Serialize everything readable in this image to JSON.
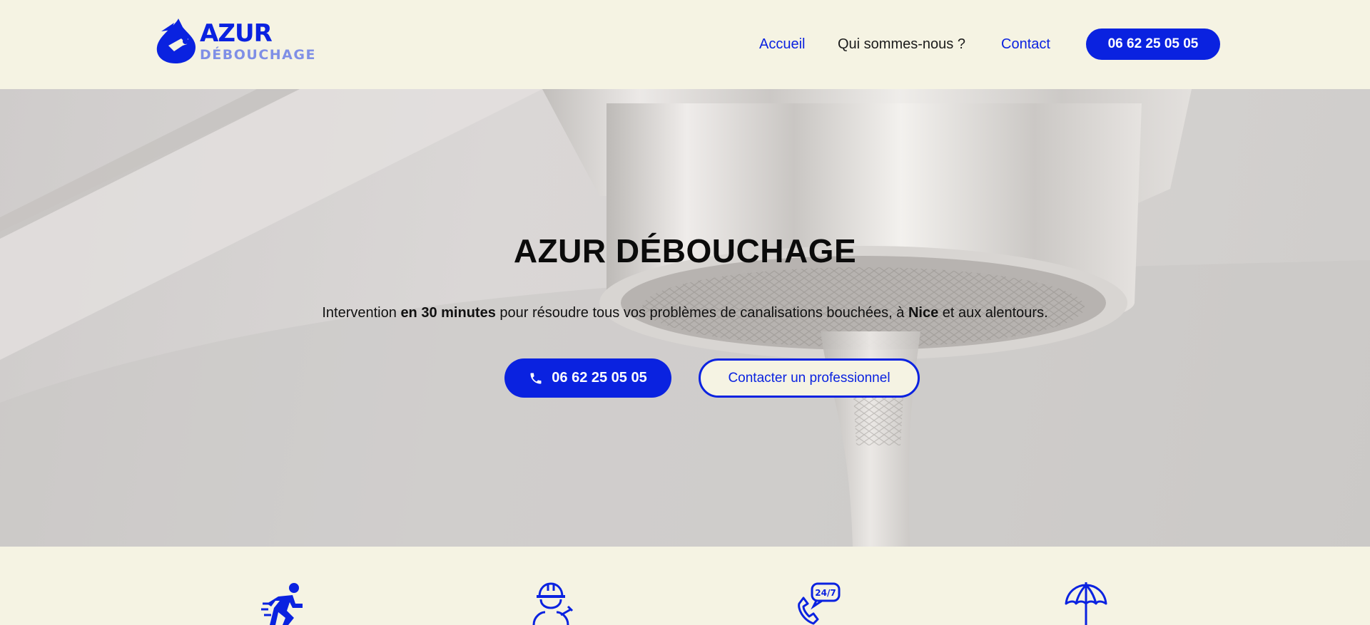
{
  "brand": {
    "name_top": "AZUR",
    "name_bottom": "DÉBOUCHAGE",
    "primary_color": "#0a22e0",
    "secondary_color": "#7f8fe6",
    "background_color": "#f5f3e3"
  },
  "nav": {
    "items": [
      {
        "label": "Accueil",
        "active": true
      },
      {
        "label": "Qui sommes-nous ?",
        "active": false
      },
      {
        "label": "Contact",
        "active": false
      }
    ],
    "phone_label": "06 62 25 05 05"
  },
  "hero": {
    "title": "AZUR DÉBOUCHAGE",
    "subtitle": {
      "p1": "Intervention ",
      "b1": "en 30 minutes",
      "p2": " pour résoudre tous vos problèmes de canalisations bouchées, à ",
      "b2": "Nice",
      "p3": " et aux alentours."
    },
    "phone_button": "06 62 25 05 05",
    "contact_button": "Contacter un professionnel"
  },
  "features": {
    "icons": [
      "running-person-icon",
      "plumber-worker-icon",
      "phone-24-7-icon",
      "umbrella-icon"
    ]
  }
}
